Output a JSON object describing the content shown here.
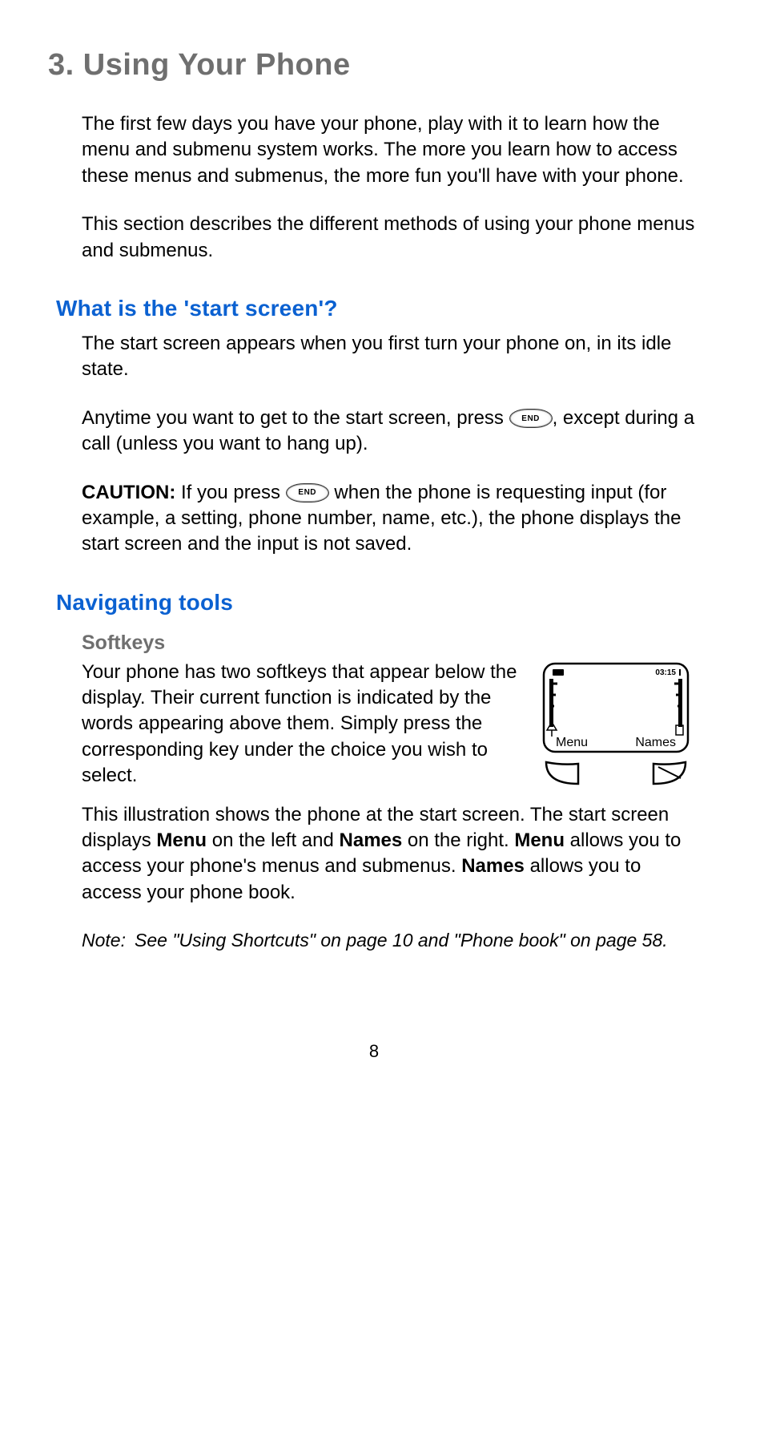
{
  "chapter": {
    "number": "3.",
    "title": "Using Your Phone"
  },
  "intro": {
    "p1": "The first few days you have your phone, play with it to learn how the menu and submenu system works. The more you learn how to access these menus and submenus, the more fun you'll have with your phone.",
    "p2": "This section describes the different methods of using your phone menus and submenus."
  },
  "start_screen": {
    "heading": "What is the 'start screen'?",
    "p1": "The start screen appears when you first turn your phone on, in its idle state.",
    "p2_pre": "Anytime you want to get to the start screen, press ",
    "p2_post": ", except during a call (unless you want to hang up).",
    "caution_label": "CAUTION:",
    "caution_pre": " If you press ",
    "caution_post": " when the phone is requesting input (for example, a setting, phone number, name, etc.), the phone displays the start screen and the input is not saved.",
    "end_key_label": "END"
  },
  "nav": {
    "heading": "Navigating tools",
    "softkeys_heading": "Softkeys",
    "softkeys_p1": "Your phone has two softkeys that appear below the display. Their current function is indicated by the words appearing above them. Simply press the corresponding key under the choice you wish to select.",
    "illustration": {
      "time": "03:15",
      "left_softkey": "Menu",
      "right_softkey": "Names"
    },
    "illu_p_a": "This illustration shows the phone at the start screen. The start screen displays ",
    "illu_b1": "Menu",
    "illu_p_b": " on the left and ",
    "illu_b2": "Names",
    "illu_p_c": " on the right. ",
    "illu_b3": "Menu",
    "illu_p_d": " allows you to access your phone's menus and submenus. ",
    "illu_b4": "Names",
    "illu_p_e": " allows you to access your phone book.",
    "note_label": "Note:",
    "note_body": "See \"Using Shortcuts\" on page 10 and \"Phone book\" on page 58."
  },
  "page_number": "8"
}
